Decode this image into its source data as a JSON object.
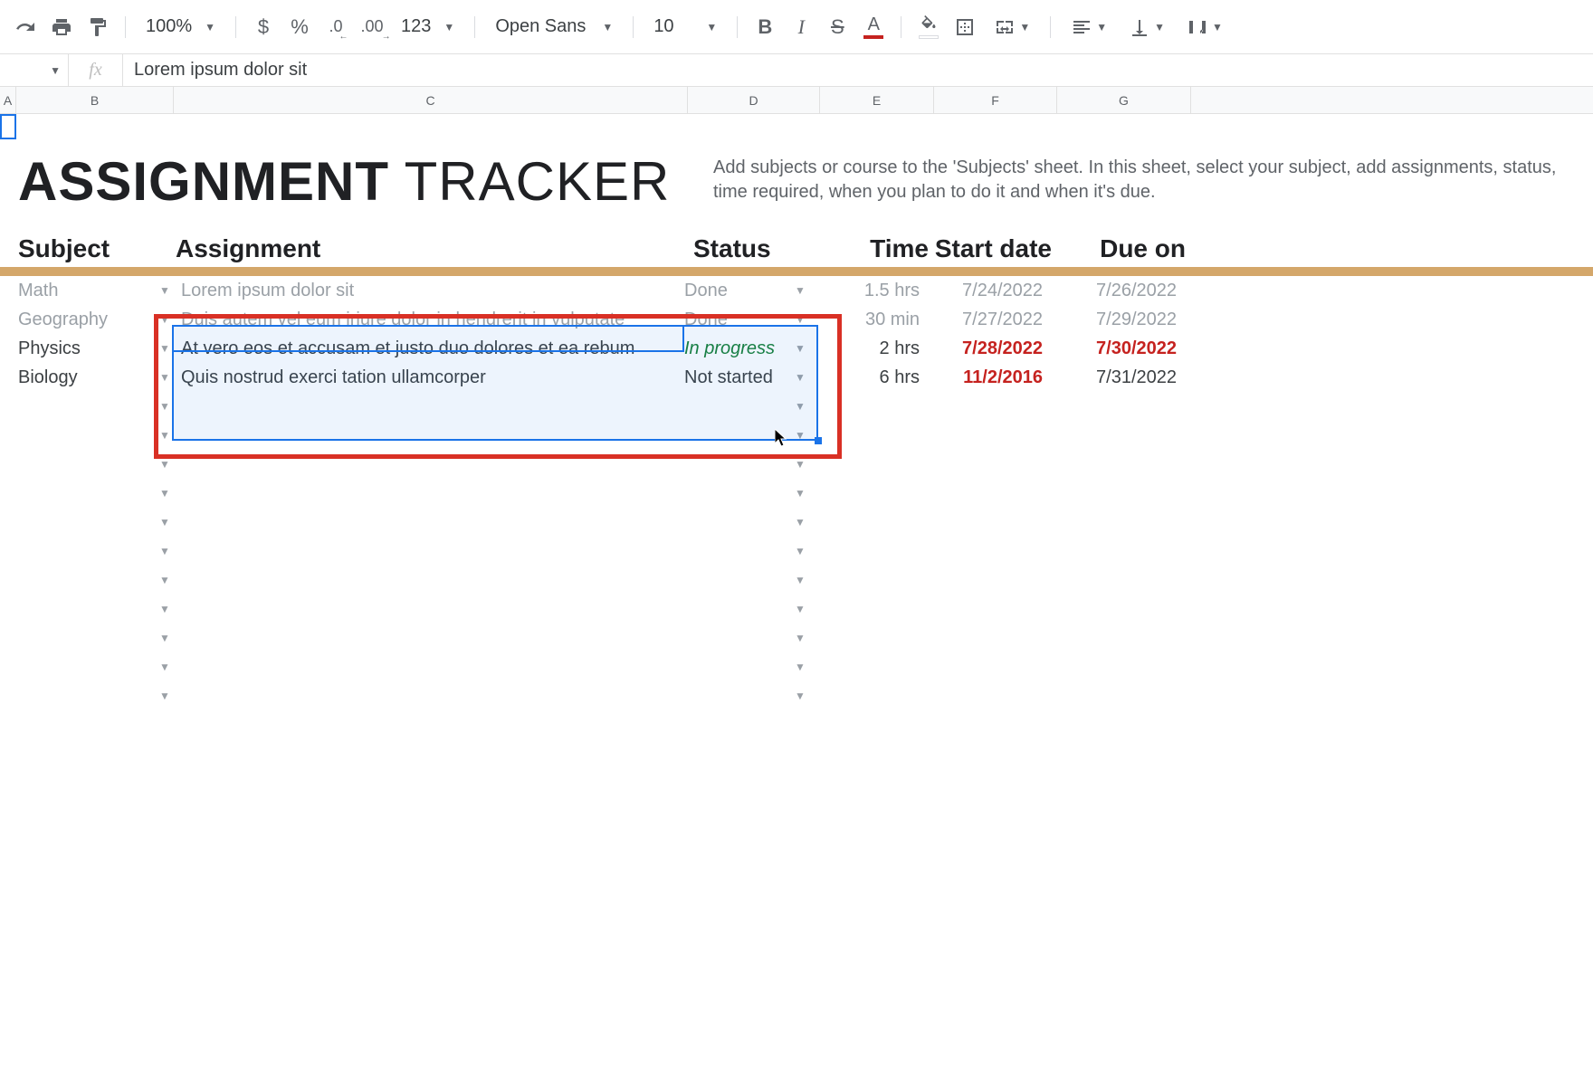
{
  "toolbar": {
    "zoom": "100%",
    "currency": "$",
    "percent": "%",
    "dec_dec": ".0",
    "inc_dec": ".00",
    "more_fmt": "123",
    "font": "Open Sans",
    "font_size": "10",
    "text_color_letter": "A",
    "text_color": "#c5221f",
    "fill_color": "#ffffff"
  },
  "formula_bar": {
    "fx": "fx",
    "value": "Lorem ipsum dolor sit"
  },
  "columns": [
    "A",
    "B",
    "C",
    "D",
    "E",
    "F",
    "G"
  ],
  "title": {
    "bold": "ASSIGNMENT",
    "light": " TRACKER"
  },
  "help_text": "Add subjects or course to the 'Subjects' sheet. In this sheet, select your subject, add assignments, status, time required, when you plan to do it and when it's due.",
  "headers": {
    "subject": "Subject",
    "assignment": "Assignment",
    "status": "Status",
    "time": "Time",
    "start": "Start date",
    "due": "Due on"
  },
  "rows": [
    {
      "subject": "Math",
      "assignment": "Lorem ipsum dolor sit",
      "status": "Done",
      "time": "1.5 hrs",
      "start": "7/24/2022",
      "due": "7/26/2022",
      "muted": true
    },
    {
      "subject": "Geography",
      "assignment": "Duis autem vel eum iriure dolor in hendrerit in vulputate",
      "status": "Done",
      "time": "30 min",
      "start": "7/27/2022",
      "due": "7/29/2022",
      "muted": true
    },
    {
      "subject": "Physics",
      "assignment": "At vero eos et accusam et justo duo dolores et ea rebum",
      "status": "In progress",
      "status_class": "green-italic",
      "time": "2 hrs",
      "start": "7/28/2022",
      "start_class": "red-bold",
      "due": "7/30/2022",
      "due_class": "red-bold"
    },
    {
      "subject": "Biology",
      "assignment": "Quis nostrud exerci tation ullamcorper",
      "status": "Not started",
      "time": "6 hrs",
      "start": "11/2/2016",
      "start_class": "red-bold",
      "due": "7/31/2022"
    }
  ],
  "empty_row_count": 11
}
